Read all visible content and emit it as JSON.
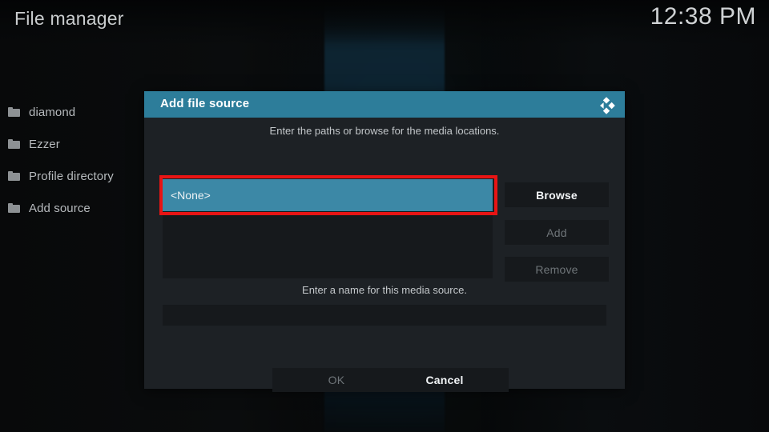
{
  "header": {
    "title": "File manager",
    "clock": "12:38 PM"
  },
  "sidebar": {
    "items": [
      {
        "label": "diamond",
        "icon": "folder-icon"
      },
      {
        "label": "Ezzer",
        "icon": "folder-icon"
      },
      {
        "label": "Profile directory",
        "icon": "folder-icon"
      },
      {
        "label": "Add source",
        "icon": "folder-icon"
      }
    ]
  },
  "dialog": {
    "title": "Add file source",
    "logo_icon": "kodi-logo-icon",
    "paths_hint": "Enter the paths or browse for the media locations.",
    "path_list": [
      {
        "label": "<None>",
        "selected": true
      }
    ],
    "side_buttons": [
      {
        "label": "Browse",
        "enabled": true
      },
      {
        "label": "Add",
        "enabled": false
      },
      {
        "label": "Remove",
        "enabled": false
      }
    ],
    "name_hint": "Enter a name for this media source.",
    "name_value": "",
    "name_placeholder": "",
    "footer_buttons": [
      {
        "label": "OK",
        "enabled": false
      },
      {
        "label": "Cancel",
        "enabled": true
      }
    ]
  },
  "annotation": {
    "color": "#e81414",
    "target": "path-row-none"
  },
  "colors": {
    "accent_teal": "#2d7d9a",
    "selection_teal": "#3c88a6",
    "dialog_bg": "#1d2125",
    "control_bg": "#16191c",
    "annotation_red": "#e81414"
  }
}
